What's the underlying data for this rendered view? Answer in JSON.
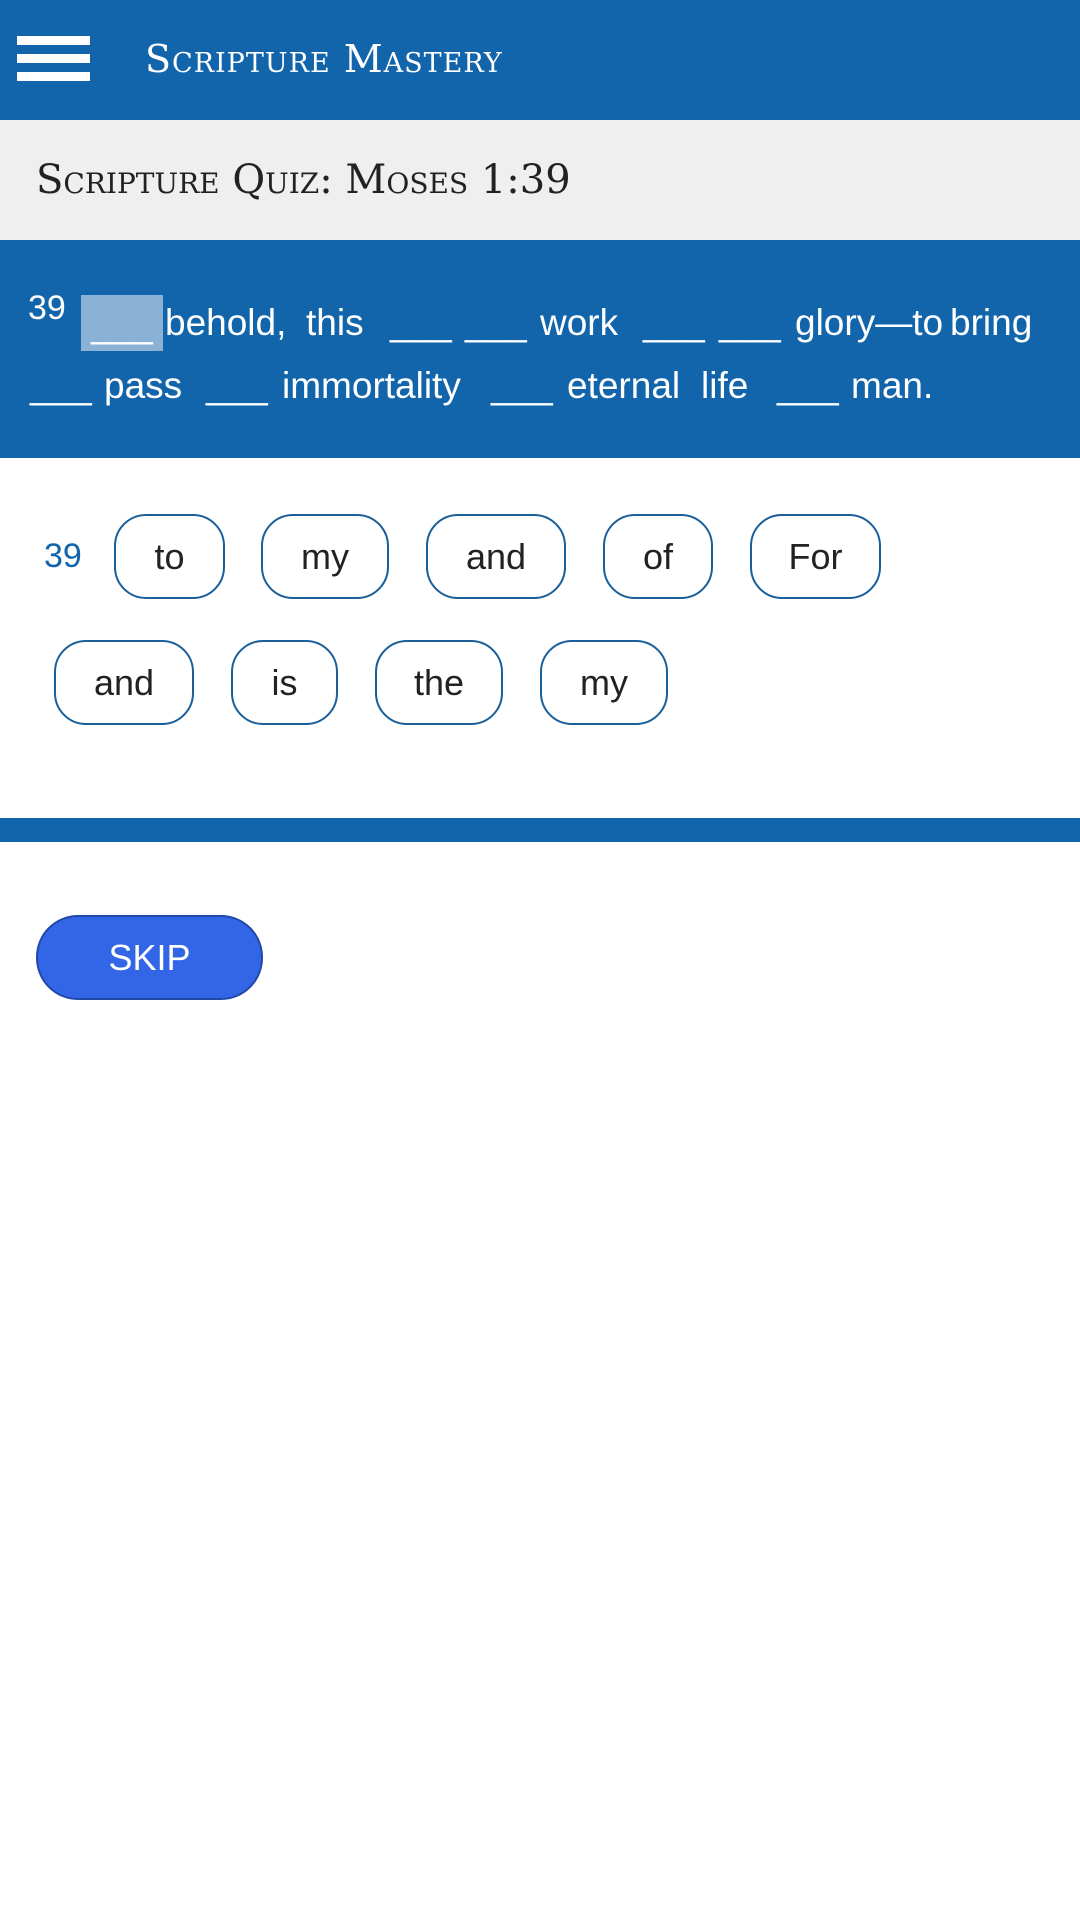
{
  "header": {
    "title": "Scripture Mastery",
    "menu_icon": "hamburger-menu-icon"
  },
  "quiz": {
    "title": "Scripture Quiz: Moses 1:39"
  },
  "verse": {
    "number": "39",
    "line1": [
      "___",
      "behold,",
      "this",
      "___",
      "___",
      "work",
      "___",
      "___",
      "glory—to",
      "bring"
    ],
    "line2": [
      "___",
      "pass",
      "___",
      "immortality",
      "___",
      "eternal",
      "life",
      "___",
      "man."
    ]
  },
  "word_bank": {
    "verse_number": "39",
    "words": [
      "to",
      "my",
      "and",
      "of",
      "For",
      "and",
      "is",
      "the",
      "my"
    ]
  },
  "actions": {
    "skip_label": "SKIP"
  },
  "colors": {
    "primary": "#1265ab",
    "active_blank": "#8ab1d6",
    "skip_button": "#3366e6",
    "subbar": "#efefef"
  }
}
